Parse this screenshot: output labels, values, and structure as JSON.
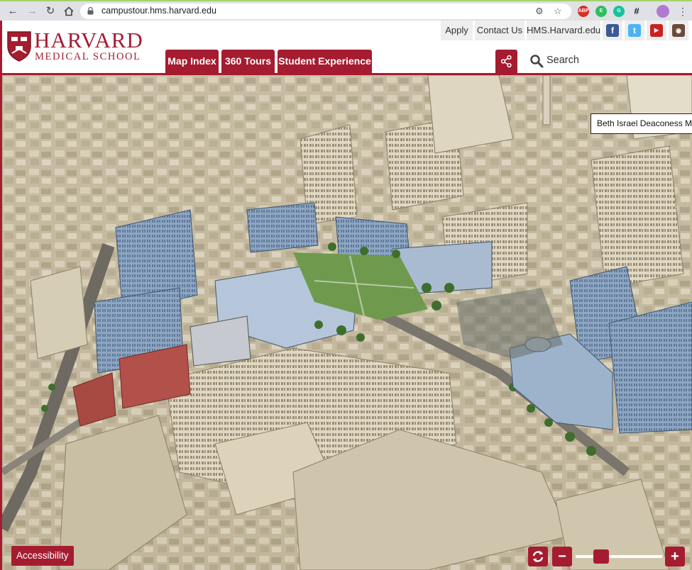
{
  "browser": {
    "url": "campustour.hms.harvard.edu"
  },
  "header": {
    "brand_line1": "HARVARD",
    "brand_line2": "MEDICAL SCHOOL",
    "top_links": [
      "Apply",
      "Contact Us",
      "HMS.Harvard.edu"
    ],
    "nav_tabs": [
      "Map Index",
      "360 Tours",
      "Student Experience"
    ],
    "search_label": "Search"
  },
  "map": {
    "tooltip": "Beth Israel Deaconess Medical Center",
    "accessibility_label": "Accessibility",
    "zoom_out_label": "−",
    "zoom_in_label": "+",
    "zoom_level": 0.25
  },
  "colors": {
    "brand_red": "#a51c30",
    "chrome_gray": "#dfe1e5"
  }
}
